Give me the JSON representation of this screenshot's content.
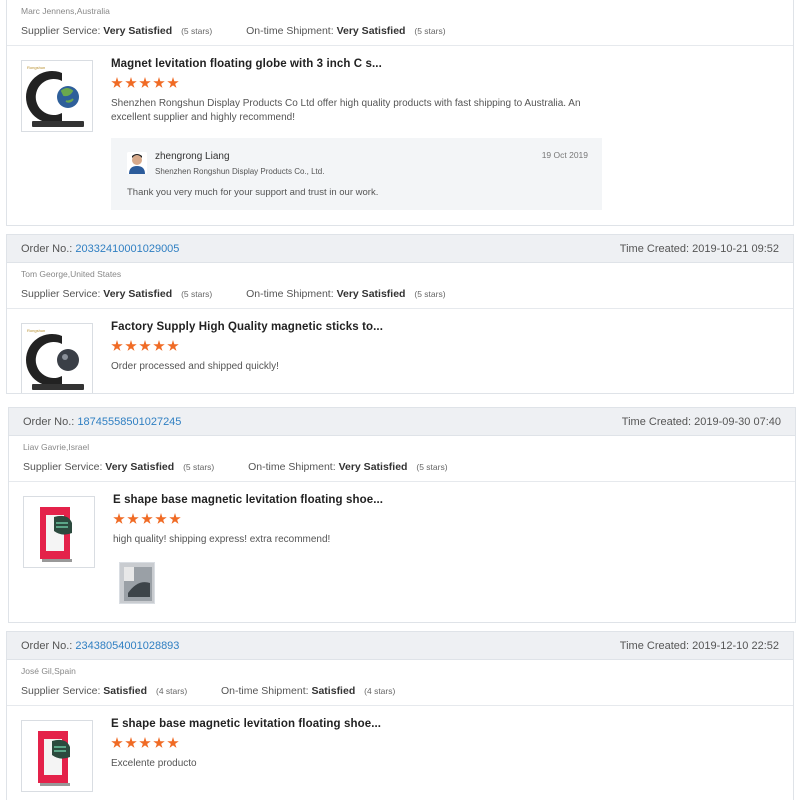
{
  "reviews": [
    {
      "buyer": "Marc Jennens,Australia",
      "supplier_service_label": "Supplier Service:",
      "supplier_service": "Very Satisfied",
      "supplier_stars": "(5 stars)",
      "shipment_label": "On-time Shipment:",
      "shipment": "Very Satisfied",
      "shipment_stars": "(5 stars)",
      "product_title": "Magnet levitation floating globe with 3 inch C s...",
      "rating": 5,
      "text": "Shenzhen Rongshun Display Products Co Ltd offer high quality products with fast shipping to Australia. An excellent supplier and highly recommend!",
      "reply": {
        "name": "zhengrong Liang",
        "company": "Shenzhen Rongshun Display Products Co., Ltd.",
        "date": "19 Oct 2019",
        "text": "Thank you very much for your support and trust in our work."
      }
    },
    {
      "order_label": "Order No.:",
      "order_no": "20332410001029005",
      "time_label": "Time Created:",
      "time": "2019-10-21 09:52",
      "buyer": "Tom George,United States",
      "supplier_service_label": "Supplier Service:",
      "supplier_service": "Very Satisfied",
      "supplier_stars": "(5 stars)",
      "shipment_label": "On-time Shipment:",
      "shipment": "Very Satisfied",
      "shipment_stars": "(5 stars)",
      "product_title": "Factory Supply High Quality magnetic sticks to...",
      "rating": 5,
      "text": "Order processed and shipped quickly!"
    },
    {
      "order_label": "Order No.:",
      "order_no": "18745558501027245",
      "time_label": "Time Created:",
      "time": "2019-09-30 07:40",
      "buyer": "Liav Gavrie,Israel",
      "supplier_service_label": "Supplier Service:",
      "supplier_service": "Very Satisfied",
      "supplier_stars": "(5 stars)",
      "shipment_label": "On-time Shipment:",
      "shipment": "Very Satisfied",
      "shipment_stars": "(5 stars)",
      "product_title": "E shape base magnetic levitation floating shoe...",
      "rating": 5,
      "text": "high quality! shipping express! extra recommend!"
    },
    {
      "order_label": "Order No.:",
      "order_no": "23438054001028893",
      "time_label": "Time Created:",
      "time": "2019-12-10 22:52",
      "buyer": "José Gil,Spain",
      "supplier_service_label": "Supplier Service:",
      "supplier_service": "Satisfied",
      "supplier_stars": "(4 stars)",
      "shipment_label": "On-time Shipment:",
      "shipment": "Satisfied",
      "shipment_stars": "(4 stars)",
      "product_title": "E shape base magnetic levitation floating shoe...",
      "rating": 5,
      "text": "Excelente producto"
    }
  ],
  "icons": {
    "product_1": "levitating-globe-icon",
    "product_2": "levitating-globe-icon",
    "product_3": "floating-shoe-icon",
    "product_4": "floating-shoe-icon",
    "avatar": "user-avatar-icon",
    "review_photo": "review-photo-icon"
  },
  "colors": {
    "star": "#f06b25",
    "order_link": "#2f7fc2",
    "header_bg": "#eef0f3",
    "reply_bg": "#f3f5f7"
  }
}
